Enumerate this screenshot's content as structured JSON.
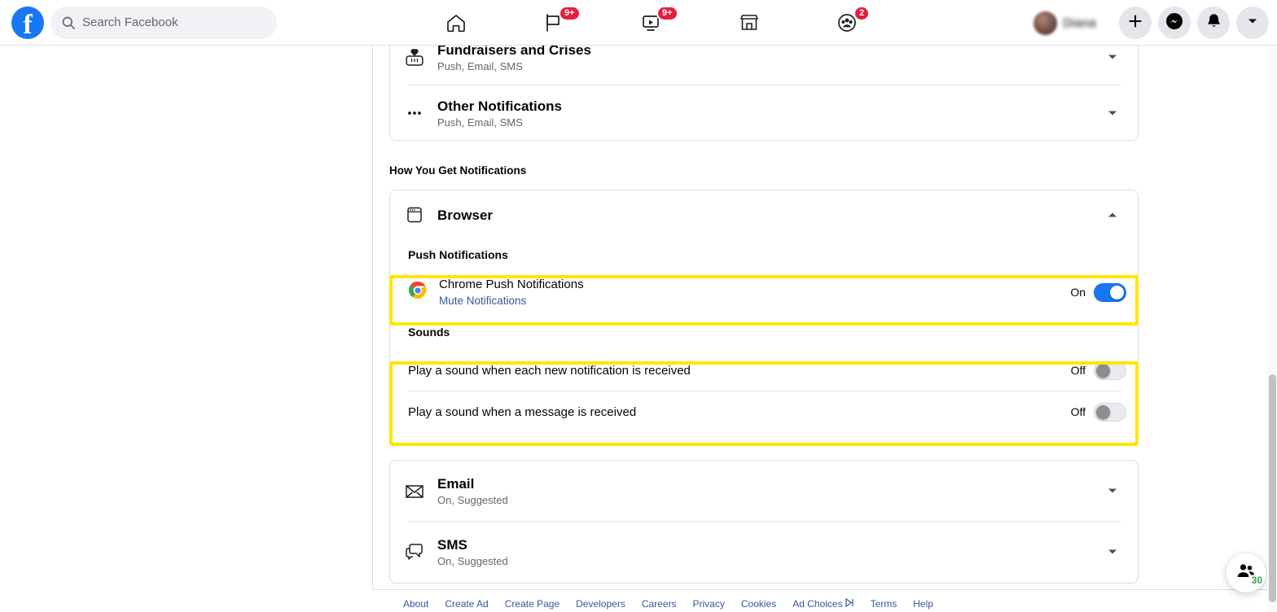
{
  "header": {
    "logo_label": "f",
    "search": {
      "placeholder": "Search Facebook",
      "icon": "search-icon"
    },
    "tabs": [
      {
        "name": "home",
        "icon": "home-icon",
        "badge": ""
      },
      {
        "name": "pages",
        "icon": "flag-icon",
        "badge": "9+"
      },
      {
        "name": "watch",
        "icon": "video-icon",
        "badge": "9+"
      },
      {
        "name": "marketplace",
        "icon": "store-icon",
        "badge": ""
      },
      {
        "name": "groups",
        "icon": "groups-icon",
        "badge": "2"
      }
    ],
    "profile_name": "Diana",
    "actions": [
      {
        "name": "create",
        "icon": "plus-icon"
      },
      {
        "name": "messenger",
        "icon": "messenger-icon"
      },
      {
        "name": "notifications",
        "icon": "bell-icon"
      },
      {
        "name": "account",
        "icon": "chevron-down-icon"
      }
    ]
  },
  "notification_types": {
    "rows": [
      {
        "icon": "heart-icon",
        "title": "Fundraisers and Crises",
        "sub": "Push, Email, SMS"
      },
      {
        "icon": "dots-icon",
        "title": "Other Notifications",
        "sub": "Push, Email, SMS"
      }
    ]
  },
  "how_you_get": {
    "section_label": "How You Get Notifications",
    "browser": {
      "icon": "browser-window-icon",
      "title": "Browser",
      "expanded": true,
      "chevron": "chevron-up-icon",
      "push_header": "Push Notifications",
      "push_item": {
        "icon": "chrome-icon",
        "name": "Chrome Push Notifications",
        "link": "Mute Notifications",
        "state": "On",
        "toggle": "on"
      },
      "sounds_header": "Sounds",
      "sounds": [
        {
          "label": "Play a sound when each new notification is received",
          "state": "Off",
          "toggle": "off"
        },
        {
          "label": "Play a sound when a message is received",
          "state": "Off",
          "toggle": "off"
        }
      ]
    },
    "channels": [
      {
        "icon": "envelope-icon",
        "title": "Email",
        "sub": "On, Suggested",
        "chevron": "chevron-down-icon"
      },
      {
        "icon": "chat-bubbles-icon",
        "title": "SMS",
        "sub": "On, Suggested",
        "chevron": "chevron-down-icon"
      }
    ]
  },
  "footer": {
    "links": [
      "About",
      "Create Ad",
      "Create Page",
      "Developers",
      "Careers",
      "Privacy",
      "Cookies",
      "Ad Choices",
      "Terms",
      "Help"
    ]
  },
  "contacts_fab": {
    "icon": "contacts-icon",
    "count": "30"
  },
  "colors": {
    "brand_blue": "#1877f2",
    "link_blue": "#385898",
    "badge_red": "#e41e3f",
    "highlight_yellow": "#ffe600",
    "green": "#31a24c"
  }
}
